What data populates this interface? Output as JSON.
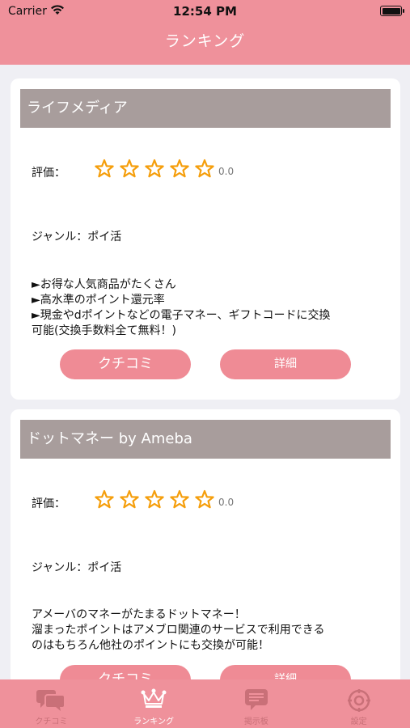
{
  "status_bar": {
    "carrier": "Carrier",
    "time": "12:54 PM"
  },
  "nav": {
    "title": "ランキング"
  },
  "cards": [
    {
      "title": "ライフメディア",
      "rating_label": "評価：",
      "score": "0.0",
      "stars_filled": 0,
      "stars_total": 5,
      "genre": "ジャンル：ポイ活",
      "description": [
        "►お得な人気商品がたくさん",
        "►高水準のポイント還元率",
        "►現金やdポイントなどの電子マネー、ギフトコードに交換",
        "可能(交換手数料全て無料！)"
      ],
      "kuchikomi_label": "クチコミ",
      "detail_label": "詳細"
    },
    {
      "title": "ドットマネー by Ameba",
      "rating_label": "評価：",
      "score": "0.0",
      "stars_filled": 0,
      "stars_total": 5,
      "genre": "ジャンル：ポイ活",
      "description": [
        "アメーバのマネーがたまるドットマネー！",
        "溜まったポイントはアメブロ関連のサービスで利用できる",
        "のはもちろん他社のポイントにも交換が可能！"
      ],
      "kuchikomi_label": "クチコミ",
      "detail_label": "詳細"
    }
  ],
  "tabs": [
    {
      "label": "クチコミ",
      "icon": "chat-bubbles-icon",
      "active": false
    },
    {
      "label": "ランキング",
      "icon": "crown-icon",
      "active": true
    },
    {
      "label": "掲示板",
      "icon": "message-board-icon",
      "active": false
    },
    {
      "label": "設定",
      "icon": "gear-icon",
      "active": false
    }
  ],
  "colors": {
    "header": "#ef919b",
    "card_title_bg": "#a89d9c",
    "button": "#ef8b95",
    "star": "#f59e0b",
    "background": "#efeff4"
  }
}
